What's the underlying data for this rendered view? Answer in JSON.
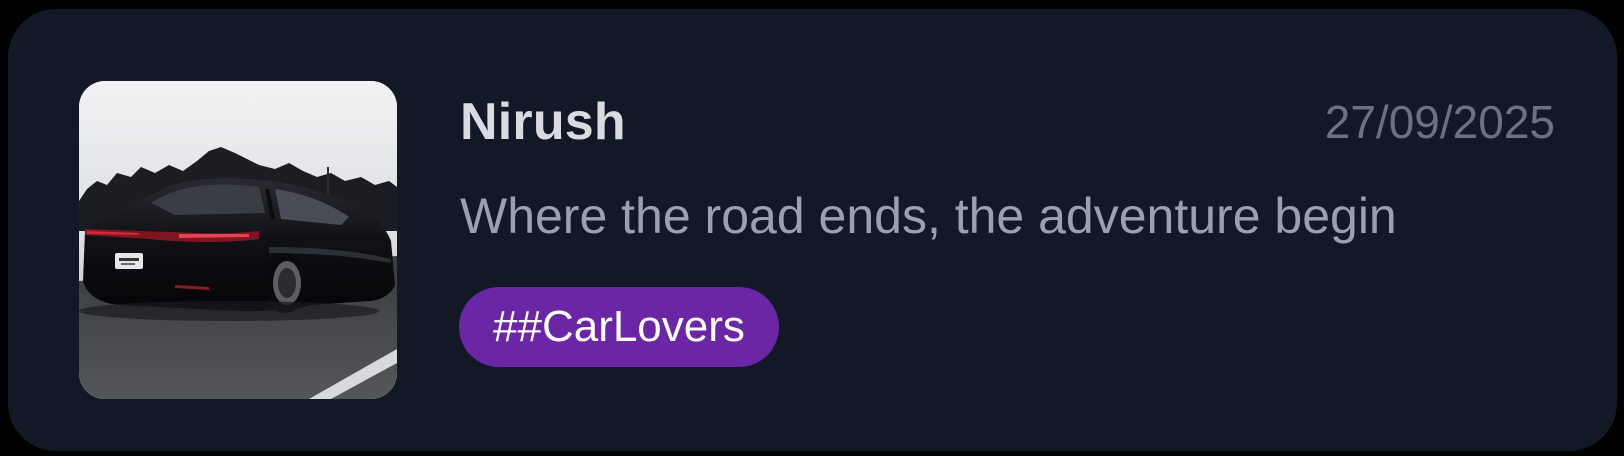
{
  "post": {
    "author": "Nirush",
    "date": "27/09/2025",
    "caption": "Where the road ends, the adventure begin",
    "tag": "##CarLovers",
    "thumbnail": {
      "subject": "black sports sedan driving on road at dusk"
    }
  },
  "colors": {
    "page_background": "#000000",
    "card_background": "#131827",
    "title_text": "#d9dbe0",
    "date_text": "#6b7183",
    "caption_text": "#9aa0ad",
    "tag_background": "#6b26a6",
    "tag_text": "#ffffff"
  }
}
